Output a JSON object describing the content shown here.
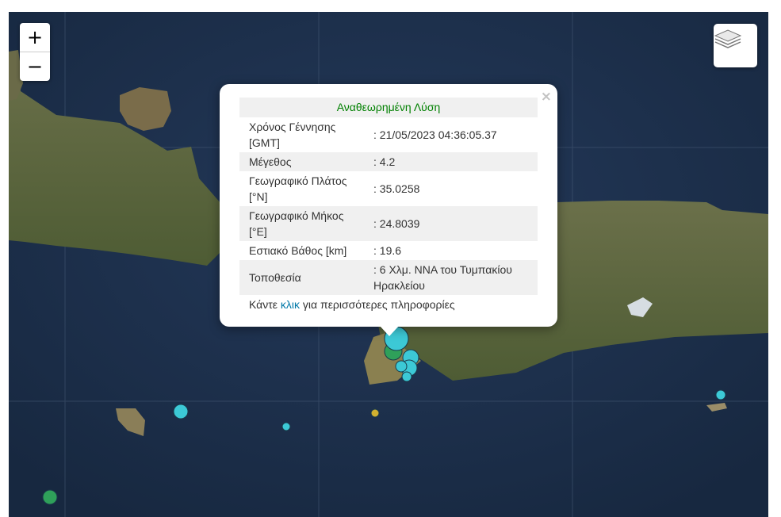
{
  "map": {
    "zoom_in_label": "+",
    "zoom_out_label": "−",
    "layers_icon": "layers-icon",
    "close_label": "×",
    "colors": {
      "sea": "#1b2f49",
      "land": "#5c6a3c",
      "quake_recent": "#3cc9d6",
      "quake_mid": "#2fa05a",
      "quake_old": "#d1b130"
    }
  },
  "popup": {
    "title": "Αναθεωρημένη Λύση",
    "rows": [
      {
        "label": "Χρόνος Γέννησης [GMT]",
        "value": ": 21/05/2023 04:36:05.37"
      },
      {
        "label": "Μέγεθος",
        "value": ": 4.2"
      },
      {
        "label": "Γεωγραφικό Πλάτος [°N]",
        "value": ": 35.0258"
      },
      {
        "label": "Γεωγραφικό Μήκος [°E]",
        "value": ": 24.8039"
      },
      {
        "label": "Εστιακό Βάθος [km]",
        "value": ": 19.6"
      },
      {
        "label": "Τοποθεσία",
        "value": ": 6 Χλμ. ΝΝΑ του Τυμπακίου Ηρακλείου"
      }
    ],
    "more_prefix": "Κάντε ",
    "more_link": "κλικ",
    "more_suffix": " για περισσότερες πληροφορίες"
  }
}
